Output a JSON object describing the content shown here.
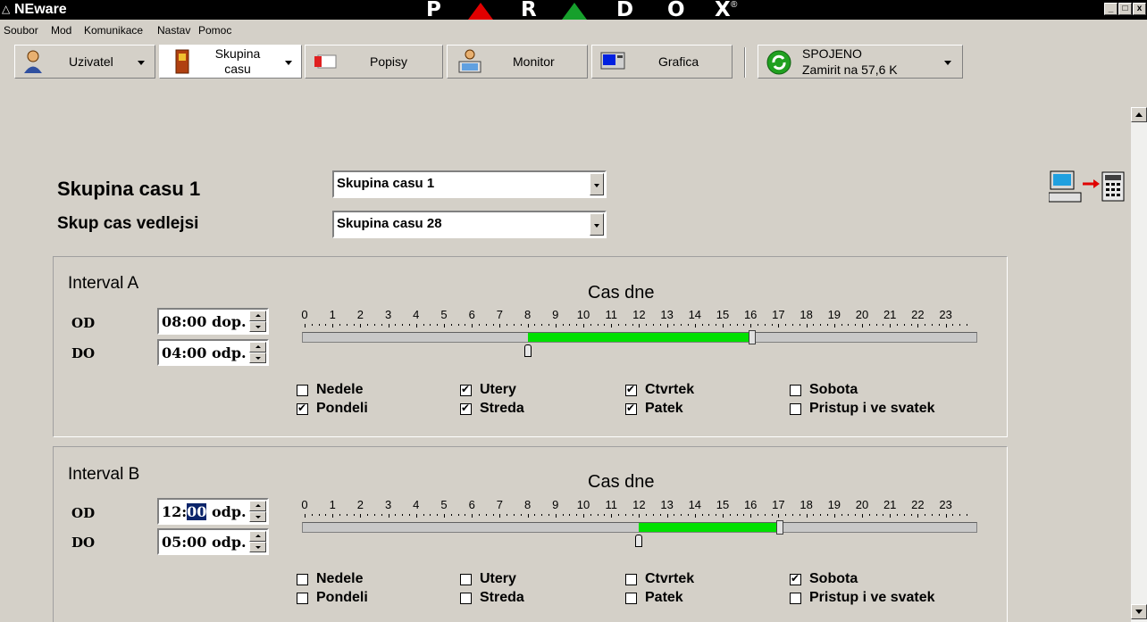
{
  "titlebar": {
    "app_name": "NEware",
    "brand_letters": [
      "P",
      "R",
      "D",
      "O",
      "X"
    ],
    "brand_registered": "®",
    "brand_colors": {
      "triangle1": "#e10000",
      "triangle2": "#16a02c"
    }
  },
  "menu": [
    "Soubor",
    "Mod",
    "Komunikace",
    "Nastav",
    "Pomoc"
  ],
  "toolbar": {
    "uzivatel": "Uzivatel",
    "skupina_line1": "Skupina",
    "skupina_line2": "casu",
    "popisy": "Popisy",
    "monitor": "Monitor",
    "grafica": "Grafica",
    "status_line1": "SPOJENO",
    "status_line2": "Zamirit na  57,6 K"
  },
  "header": {
    "group_title": "Skupina casu 1",
    "group_select_value": "Skupina casu 1",
    "secondary_label": "Skup cas vedlejsi",
    "secondary_select_value": "Skupina casu 28"
  },
  "intervals": [
    {
      "title": "Interval A",
      "timeline_title": "Cas dne",
      "od_label": "OD",
      "do_label": "DO",
      "od_prefix": "08:",
      "od_selected": "00",
      "od_suffix": " dop.",
      "do_value": "04:00 odp.",
      "range_start_hour": 8,
      "range_end_hour": 16,
      "days": [
        {
          "label": "Nedele",
          "checked": false
        },
        {
          "label": "Utery",
          "checked": true
        },
        {
          "label": "Ctvrtek",
          "checked": true
        },
        {
          "label": "Sobota",
          "checked": false
        },
        {
          "label": "Pondeli",
          "checked": true
        },
        {
          "label": "Streda",
          "checked": true
        },
        {
          "label": "Patek",
          "checked": true
        },
        {
          "label": "Pristup i ve svatek",
          "checked": false
        }
      ]
    },
    {
      "title": "Interval B",
      "timeline_title": "Cas dne",
      "od_label": "OD",
      "do_label": "DO",
      "od_prefix": "12:",
      "od_selected": "00",
      "od_suffix": " odp.",
      "do_value": "05:00 odp.",
      "range_start_hour": 12,
      "range_end_hour": 17,
      "days": [
        {
          "label": "Nedele",
          "checked": false
        },
        {
          "label": "Utery",
          "checked": false
        },
        {
          "label": "Ctvrtek",
          "checked": false
        },
        {
          "label": "Sobota",
          "checked": true
        },
        {
          "label": "Pondeli",
          "checked": false
        },
        {
          "label": "Streda",
          "checked": false
        },
        {
          "label": "Patek",
          "checked": false
        },
        {
          "label": "Pristup i ve svatek",
          "checked": false
        }
      ]
    }
  ],
  "hours": [
    "0",
    "1",
    "2",
    "3",
    "4",
    "5",
    "6",
    "7",
    "8",
    "9",
    "10",
    "11",
    "12",
    "13",
    "14",
    "15",
    "16",
    "17",
    "18",
    "19",
    "20",
    "21",
    "22",
    "23"
  ],
  "colors": {
    "selection_fill": "#00e000",
    "window_bg": "#d4d0c8"
  }
}
